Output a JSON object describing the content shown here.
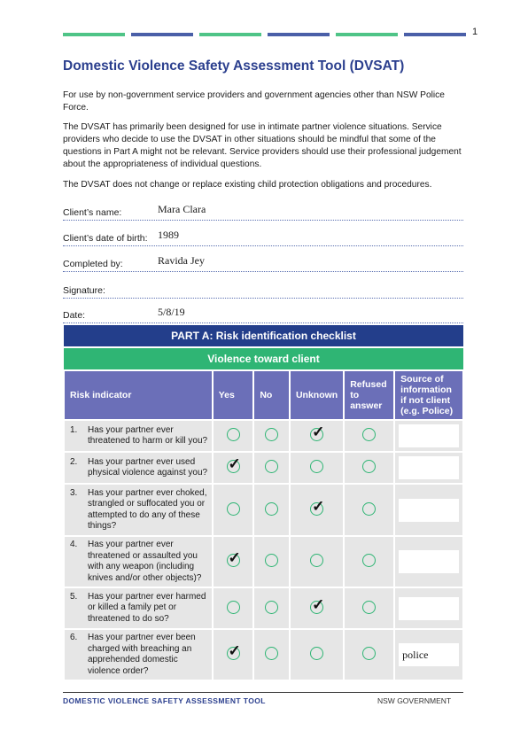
{
  "page_number": "1",
  "header_colors": [
    "#4fc487",
    "#4a5fa8",
    "#4fc487",
    "#4a5fa8",
    "#4fc487",
    "#4a5fa8"
  ],
  "title": "Domestic Violence Safety Assessment Tool (DVSAT)",
  "paragraphs": [
    "For use by non-government service providers and government agencies other than NSW Police Force.",
    "The DVSAT has primarily been designed for use in intimate partner violence situations. Service providers who decide to use the DVSAT in other situations should be mindful that some of the questions in Part A might not be relevant. Service providers should use their professional judgement about the appropriateness of individual questions.",
    "The DVSAT does not change or replace existing child protection obligations and procedures."
  ],
  "fields": [
    {
      "label": "Client’s name:",
      "value": "Mara Clara"
    },
    {
      "label": "Client’s date of birth:",
      "value": "1989"
    },
    {
      "label": "Completed by:",
      "value": "Ravida Jey"
    },
    {
      "label": "Signature:",
      "value": ""
    },
    {
      "label": "Date:",
      "value": "5/8/19"
    }
  ],
  "table": {
    "part_title": "PART A: Risk identification checklist",
    "section_title": "Violence toward client",
    "headers": [
      "Risk indicator",
      "Yes",
      "No",
      "Unknown",
      "Refused to answer",
      "Source of information if not client (e.g. Police)"
    ],
    "rows": [
      {
        "num": "1.",
        "question": "Has your partner ever threatened to harm or kill you?",
        "answer": "Unknown",
        "source": ""
      },
      {
        "num": "2.",
        "question": "Has your partner ever used physical violence against you?",
        "answer": "Yes",
        "source": ""
      },
      {
        "num": "3.",
        "question": "Has your partner ever choked, strangled or suffocated you or attempted to do any of these things?",
        "answer": "Unknown",
        "source": ""
      },
      {
        "num": "4.",
        "question": "Has your partner ever threatened or assaulted you with any weapon (including knives and/or other objects)?",
        "answer": "Yes",
        "source": ""
      },
      {
        "num": "5.",
        "question": "Has your partner ever harmed or killed a family pet or threatened to do so?",
        "answer": "Unknown",
        "source": ""
      },
      {
        "num": "6.",
        "question": "Has your partner ever been charged with breaching an apprehended domestic violence order?",
        "answer": "Yes",
        "source": "police"
      }
    ]
  },
  "footer": {
    "left": "DOMESTIC VIOLENCE SAFETY ASSESSMENT TOOL",
    "right": "NSW GOVERNMENT"
  }
}
